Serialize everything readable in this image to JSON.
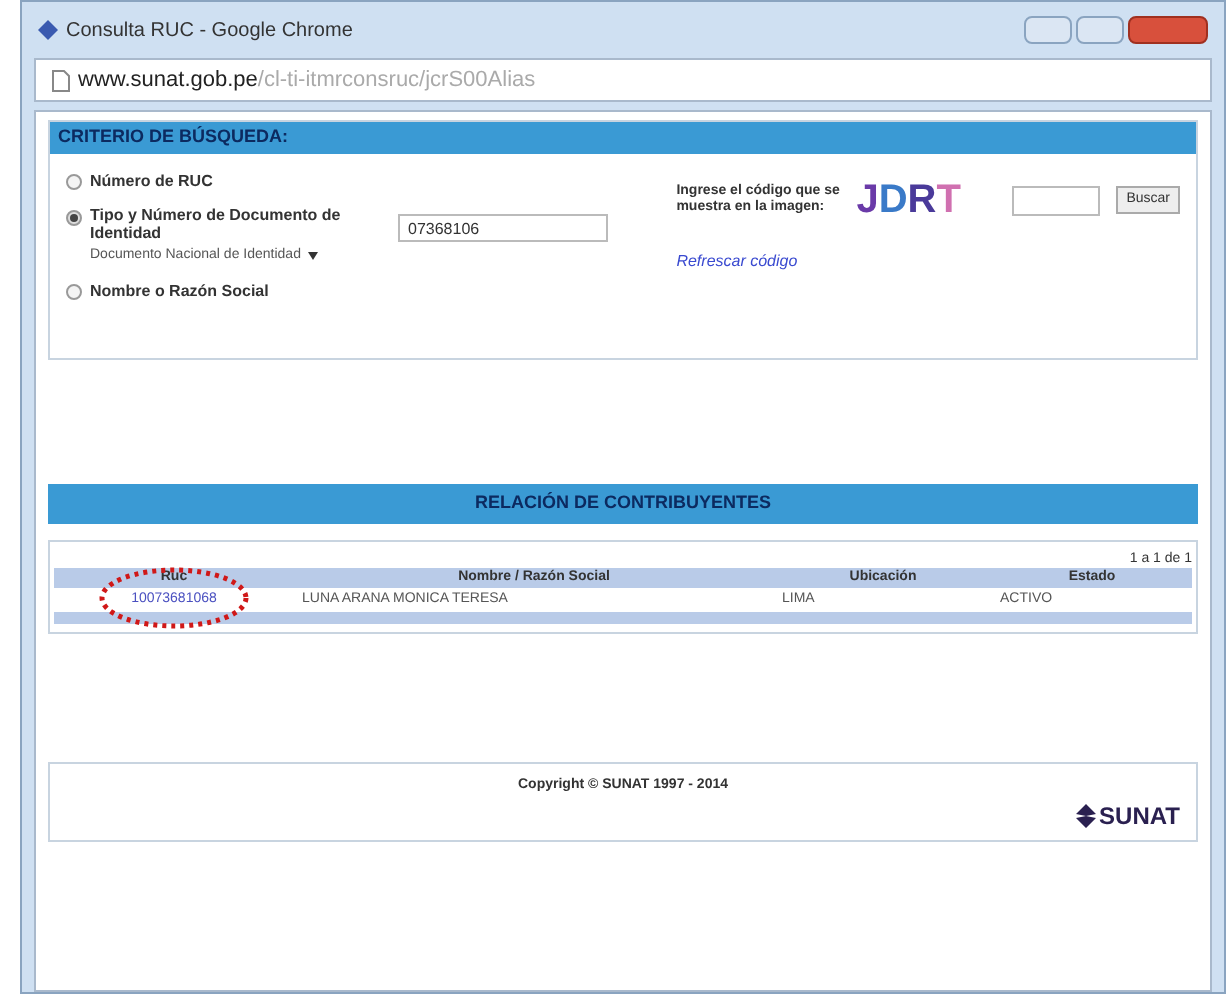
{
  "window": {
    "title": "Consulta RUC - Google Chrome"
  },
  "address_bar": {
    "host": "www.sunat.gob.pe",
    "path": "/cl-ti-itmrconsruc/jcrS00Alias"
  },
  "criteria": {
    "title": "CRITERIO DE BÚSQUEDA:",
    "options": [
      {
        "kind": "plain",
        "label": "Número de RUC",
        "selected": false
      },
      {
        "kind": "document",
        "label": "Tipo y Número de Documento de Identidad",
        "selected": true,
        "document_type": "Documento Nacional de Identidad",
        "value": "07368106"
      },
      {
        "kind": "plain",
        "label": "Nombre o Razón Social",
        "selected": false
      }
    ],
    "captcha_prompt": "Ingrese el código que se muestra en la imagen:",
    "captcha_letters": [
      {
        "char": "J",
        "color": "#6a3aa8"
      },
      {
        "char": "D",
        "color": "#3a7ac8"
      },
      {
        "char": "R",
        "color": "#4a3a9a"
      },
      {
        "char": "T",
        "color": "#d070b0"
      }
    ],
    "search_button": "Buscar",
    "refresh_link": "Refrescar código"
  },
  "results": {
    "title": "RELACIÓN DE CONTRIBUYENTES",
    "pagination": "1 a 1 de 1",
    "columns": [
      "Ruc",
      "Nombre / Razón Social",
      "Ubicación",
      "Estado"
    ],
    "rows": [
      [
        "10073681068",
        "LUNA ARANA MONICA TERESA",
        "LIMA",
        "ACTIVO"
      ]
    ]
  },
  "footer": {
    "copyright": "Copyright © SUNAT 1997 - 2014",
    "logo": "SUNAT"
  }
}
